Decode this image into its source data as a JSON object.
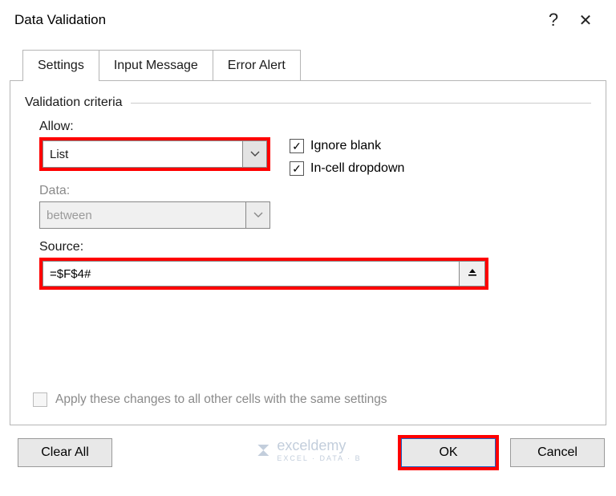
{
  "title": "Data Validation",
  "titlebar": {
    "help_label": "?",
    "close_label": "✕"
  },
  "tabs": [
    {
      "label": "Settings",
      "active": true
    },
    {
      "label": "Input Message",
      "active": false
    },
    {
      "label": "Error Alert",
      "active": false
    }
  ],
  "group": {
    "title": "Validation criteria",
    "allow_label": "Allow:",
    "allow_value": "List",
    "data_label": "Data:",
    "data_value": "between",
    "source_label": "Source:",
    "source_value": "=$F$4#"
  },
  "checks": {
    "ignore_blank": {
      "label": "Ignore blank",
      "checked": true
    },
    "incell_dropdown": {
      "label": "In-cell dropdown",
      "checked": true
    },
    "apply_all": {
      "label": "Apply these changes to all other cells with the same settings",
      "checked": false
    }
  },
  "buttons": {
    "clear_all": "Clear All",
    "ok": "OK",
    "cancel": "Cancel"
  },
  "watermark": {
    "brand": "exceldemy",
    "tagline": "EXCEL · DATA · B"
  },
  "colors": {
    "highlight": "#ff0000",
    "primary_border": "#1a5fc2"
  }
}
